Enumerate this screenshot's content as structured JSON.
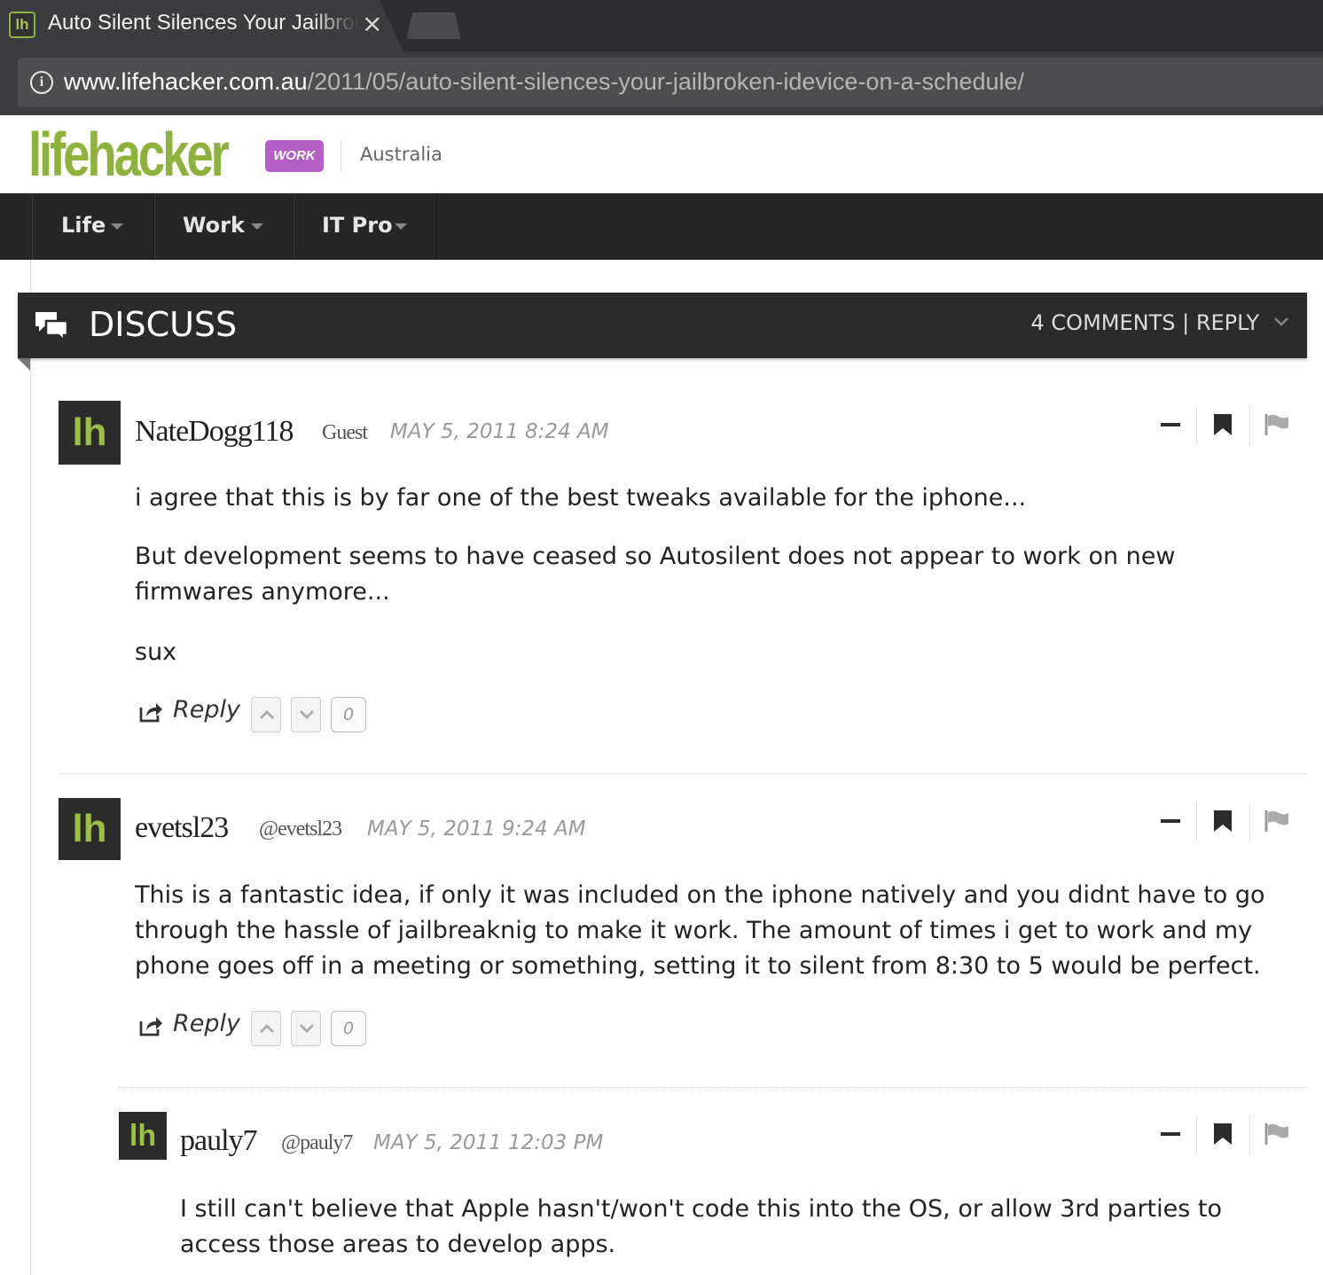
{
  "browser": {
    "tab_title": "Auto Silent Silences Your Jailbroken iDevice On A Schedule",
    "tab_close": "×",
    "favicon_text": "lh",
    "url_host": "www.lifehacker.com.au",
    "url_path": "/2011/05/auto-silent-silences-your-jailbroken-idevice-on-a-schedule/",
    "info_glyph": "i"
  },
  "header": {
    "logo": "lifehacker",
    "badge": "WORK",
    "region": "Australia",
    "colors": {
      "logo": "#8db33c",
      "badge": "#b35fc5",
      "nav_bg": "#262626"
    }
  },
  "nav": {
    "items": [
      {
        "label": "Life"
      },
      {
        "label": "Work"
      },
      {
        "label": "IT Pro"
      }
    ]
  },
  "discuss": {
    "title": "DISCUSS",
    "meta": "4 COMMENTS | REPLY",
    "icons": [
      "chat-bubbles-icon",
      "chevron-down-icon"
    ]
  },
  "comments": [
    {
      "avatar": "lh",
      "username": "NateDogg118",
      "role": "Guest",
      "timestamp": "MAY 5, 2011 8:24 AM",
      "paragraphs": [
        "i agree that this is by far one of the best tweaks available for the iphone...",
        "But development seems to have ceased so Autosilent does not appear to work on new firmwares anymore...",
        "sux"
      ],
      "reply_label": "Reply",
      "votes": "0"
    },
    {
      "avatar": "lh",
      "username": "evetsl23",
      "role": "@evetsl23",
      "timestamp": "MAY 5, 2011 9:24 AM",
      "paragraphs": [
        "This is a fantastic idea, if only it was included on the iphone natively and you didnt have to go through the hassle of jailbreaknig to make it work. The amount of times i get to work and my phone goes off in a meeting or something, setting it to silent from 8:30 to 5 would be perfect."
      ],
      "reply_label": "Reply",
      "votes": "0"
    },
    {
      "avatar": "lh",
      "username": "pauly7",
      "role": "@pauly7",
      "timestamp": "MAY 5, 2011 12:03 PM",
      "paragraphs": [
        "I still can't believe that Apple hasn't/won't code this into the OS, or allow 3rd parties to access those areas to develop apps."
      ]
    }
  ]
}
